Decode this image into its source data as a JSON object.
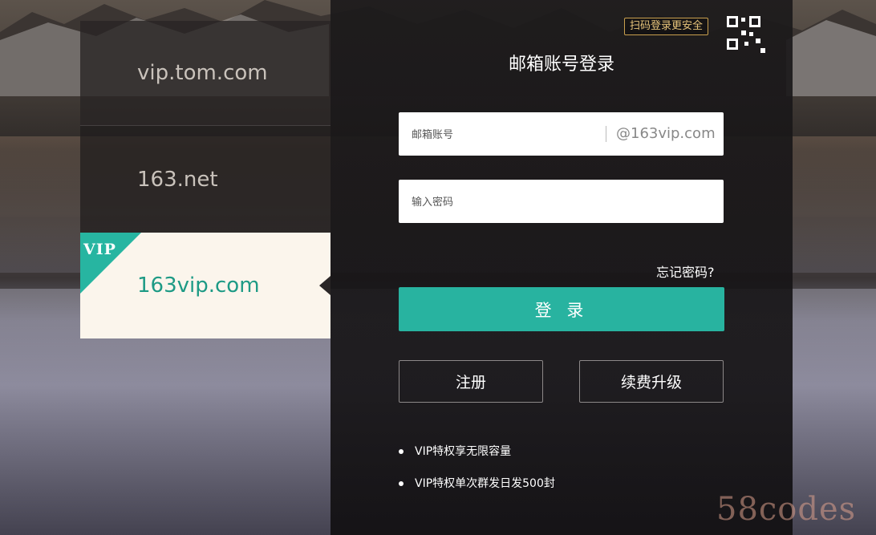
{
  "domains": [
    {
      "label": "vip.tom.com"
    },
    {
      "label": "163.net"
    },
    {
      "label": "163vip.com",
      "badge": "VIP",
      "selected": true
    }
  ],
  "login": {
    "qr_hint": "扫码登录更安全",
    "qr_icon": "qr-code-icon",
    "title": "邮箱账号登录",
    "email_placeholder": "邮箱账号",
    "email_suffix": "@163vip.com",
    "password_placeholder": "输入密码",
    "forgot": "忘记密码?",
    "login_button": "登 录",
    "register_button": "注册",
    "upgrade_button": "续费升级",
    "perks": [
      "VIP特权享无限容量",
      "VIP特权单次群发日发500封"
    ]
  },
  "watermark": "58codes",
  "colors": {
    "accent": "#28b3a0",
    "vip_badge": "#27b5a1",
    "qr_hint": "#c9a04e"
  }
}
